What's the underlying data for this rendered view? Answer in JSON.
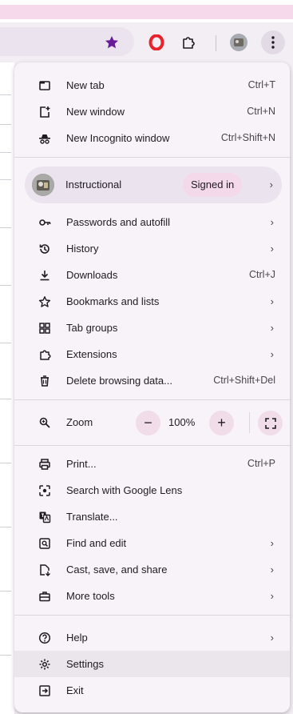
{
  "browser": {
    "icons": [
      "bookmark-star-icon",
      "opera-icon",
      "extensions-puzzle-icon",
      "profile-avatar-icon",
      "kebab-menu-icon"
    ],
    "accent_color": "#6a1b9a"
  },
  "menu": {
    "group1": [
      {
        "label": "New tab",
        "shortcut": "Ctrl+T",
        "icon": "new-tab-icon"
      },
      {
        "label": "New window",
        "shortcut": "Ctrl+N",
        "icon": "new-window-icon"
      },
      {
        "label": "New Incognito window",
        "shortcut": "Ctrl+Shift+N",
        "icon": "incognito-icon"
      }
    ],
    "profile": {
      "name": "Instructional",
      "status": "Signed in",
      "chevron": "›"
    },
    "group2": [
      {
        "label": "Passwords and autofill",
        "chevron": "›",
        "icon": "key-icon"
      },
      {
        "label": "History",
        "chevron": "›",
        "icon": "history-icon"
      },
      {
        "label": "Downloads",
        "shortcut": "Ctrl+J",
        "icon": "download-icon"
      },
      {
        "label": "Bookmarks and lists",
        "chevron": "›",
        "icon": "star-icon"
      },
      {
        "label": "Tab groups",
        "chevron": "›",
        "icon": "tab-groups-icon"
      },
      {
        "label": "Extensions",
        "chevron": "›",
        "icon": "puzzle-icon"
      },
      {
        "label": "Delete browsing data...",
        "shortcut": "Ctrl+Shift+Del",
        "icon": "trash-icon"
      }
    ],
    "zoom": {
      "label": "Zoom",
      "minus": "−",
      "value": "100%",
      "plus": "+"
    },
    "group3": [
      {
        "label": "Print...",
        "shortcut": "Ctrl+P",
        "icon": "print-icon"
      },
      {
        "label": "Search with Google Lens",
        "icon": "lens-icon"
      },
      {
        "label": "Translate...",
        "icon": "translate-icon"
      },
      {
        "label": "Find and edit",
        "chevron": "›",
        "icon": "find-icon"
      },
      {
        "label": "Cast, save, and share",
        "chevron": "›",
        "icon": "cast-icon"
      },
      {
        "label": "More tools",
        "chevron": "›",
        "icon": "toolbox-icon"
      }
    ],
    "group4": [
      {
        "label": "Help",
        "chevron": "›",
        "icon": "help-icon"
      },
      {
        "label": "Settings",
        "icon": "settings-gear-icon"
      },
      {
        "label": "Exit",
        "icon": "exit-icon"
      }
    ]
  }
}
